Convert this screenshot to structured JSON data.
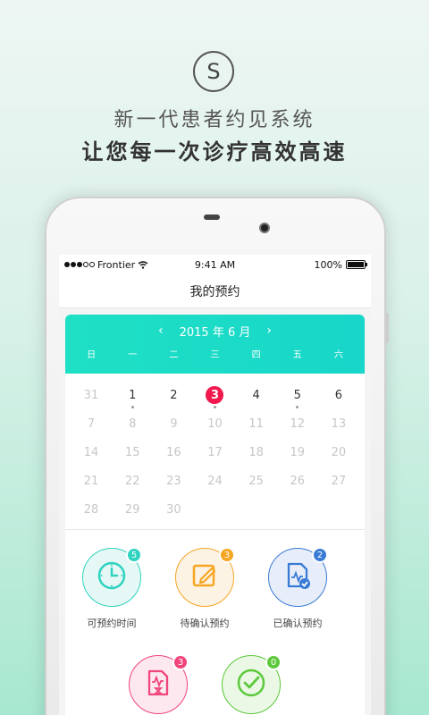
{
  "promo": {
    "logo_letter": "S",
    "line1": "新一代患者约见系统",
    "line2": "让您每一次诊疗高效高速"
  },
  "status": {
    "carrier": "Frontier",
    "time": "9:41 AM",
    "battery": "100%",
    "battery_level": 100
  },
  "nav": {
    "title": "我的预约"
  },
  "calendar": {
    "prev": "‹",
    "next": "›",
    "month_label": "2015 年 6 月",
    "weekdays": [
      "日",
      "一",
      "二",
      "三",
      "四",
      "五",
      "六"
    ],
    "days": [
      {
        "n": "31",
        "active": false
      },
      {
        "n": "1",
        "active": true,
        "mark": true
      },
      {
        "n": "2",
        "active": true
      },
      {
        "n": "3",
        "active": true,
        "today": true,
        "mark": true
      },
      {
        "n": "4",
        "active": true
      },
      {
        "n": "5",
        "active": true,
        "mark": true
      },
      {
        "n": "6",
        "active": true
      },
      {
        "n": "7"
      },
      {
        "n": "8"
      },
      {
        "n": "9"
      },
      {
        "n": "10"
      },
      {
        "n": "11"
      },
      {
        "n": "12"
      },
      {
        "n": "13"
      },
      {
        "n": "14"
      },
      {
        "n": "15"
      },
      {
        "n": "16"
      },
      {
        "n": "17"
      },
      {
        "n": "18"
      },
      {
        "n": "19"
      },
      {
        "n": "20"
      },
      {
        "n": "21"
      },
      {
        "n": "22"
      },
      {
        "n": "23"
      },
      {
        "n": "24"
      },
      {
        "n": "25"
      },
      {
        "n": "26"
      },
      {
        "n": "27"
      },
      {
        "n": "28"
      },
      {
        "n": "29"
      },
      {
        "n": "30"
      }
    ]
  },
  "actions": [
    {
      "id": "available-time",
      "label": "可预约时间",
      "badge": "5",
      "color": "#2fd3bf",
      "bg": "#e6f8f5",
      "icon": "clock-icon"
    },
    {
      "id": "pending-confirm",
      "label": "待确认预约",
      "badge": "3",
      "color": "#f5a623",
      "bg": "#fdf3e4",
      "icon": "edit-icon"
    },
    {
      "id": "confirmed",
      "label": "已确认预约",
      "badge": "2",
      "color": "#3a7bd5",
      "bg": "#e7eefa",
      "icon": "document-check-icon"
    },
    {
      "id": "record",
      "label": "",
      "badge": "3",
      "color": "#f0457a",
      "bg": "#fde8ef",
      "icon": "medical-record-icon"
    },
    {
      "id": "completed",
      "label": "",
      "badge": "0",
      "color": "#5cc93c",
      "bg": "#eaf8e5",
      "icon": "check-circle-icon"
    }
  ]
}
